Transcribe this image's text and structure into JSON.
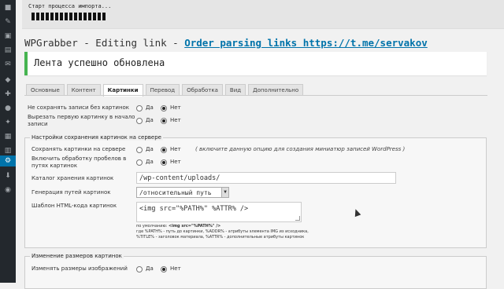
{
  "import": {
    "status_text": "Старт процесса импорта...",
    "progress_segments": 16
  },
  "header": {
    "title_prefix": "WPGrabber - Editing link - ",
    "title_link": "Order parsing links https://t.me/servakov"
  },
  "notice": {
    "message": "Лента успешно обновлена"
  },
  "tabs": [
    {
      "label": "Основные",
      "active": false
    },
    {
      "label": "Контент",
      "active": false
    },
    {
      "label": "Картинки",
      "active": true
    },
    {
      "label": "Перевод",
      "active": false
    },
    {
      "label": "Обработка",
      "active": false
    },
    {
      "label": "Вид",
      "active": false
    },
    {
      "label": "Дополнительно",
      "active": false
    }
  ],
  "radio_labels": {
    "yes": "Да",
    "no": "Нет"
  },
  "general": {
    "no_save_without_images": {
      "label": "Не сохранять записи без картинок",
      "value": "no"
    },
    "cut_first_image": {
      "label1": "Вырезать первую картинку в начало",
      "label2": "записи",
      "value": "no"
    }
  },
  "server_section": {
    "legend": "Настройки сохранения картинок на сервере",
    "save_images": {
      "label": "Сохранять картинки на сервере",
      "value": "no",
      "hint": "( включите данную опцию для создания миниатюр записей WordPress )"
    },
    "space_processing": {
      "label1": "Включить обработку пробелов в",
      "label2": "путях картинок",
      "value": "yes"
    },
    "storage_dir": {
      "label": "Каталог хранения картинок",
      "value": "/wp-content/uploads/"
    },
    "path_gen": {
      "label": "Генерация путей картинок",
      "value": "/относительный путь"
    },
    "html_template": {
      "label": "Шаблон HTML-кода картинок",
      "value": "<img src=\"%PATH%\" %ATTR% />",
      "default_prefix": "по умолчанию: ",
      "default_value": "<img src=\"%PATH%\" />",
      "help1": "где %PATH% - путь до картинки, %ADDR% - атрибуты элемента IMG из исходника,",
      "help2": "%TITLE% - заголовок материала, %ATTR% - дополнительные атрибуты картинок"
    }
  },
  "resize_section": {
    "legend": "Изменение размеров картинок",
    "resize_images": {
      "label": "Изменять размеры изображений",
      "value": "no"
    }
  },
  "colors": {
    "accent": "#0073aa",
    "success": "#46b450",
    "adminbar": "#23282d"
  }
}
